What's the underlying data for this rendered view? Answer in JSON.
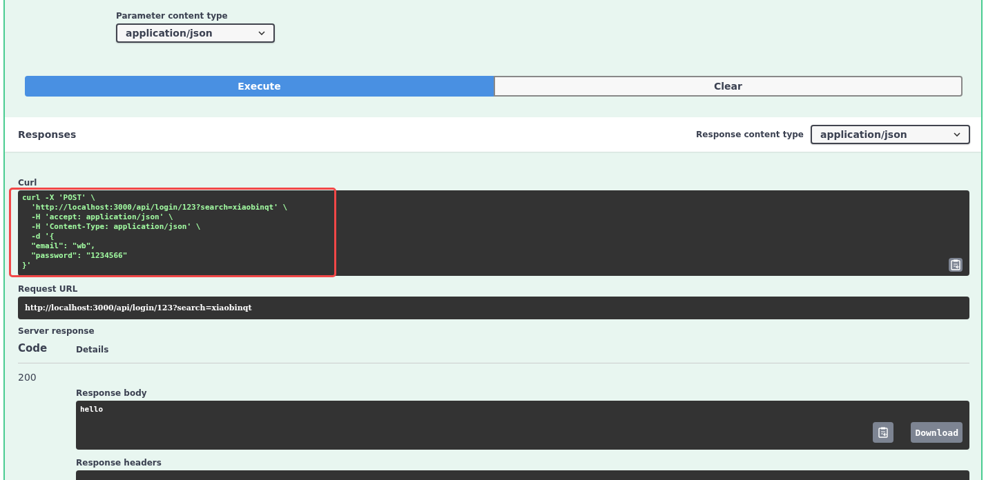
{
  "parameter_content_type": {
    "label": "Parameter content type",
    "value": "application/json"
  },
  "actions": [
    {
      "label": "Execute",
      "kind": "primary"
    },
    {
      "label": "Clear",
      "kind": "secondary"
    }
  ],
  "responses": {
    "title": "Responses",
    "content_type_label": "Response content type",
    "content_type_value": "application/json"
  },
  "curl": {
    "label": "Curl",
    "highlighted": true,
    "lines": [
      "curl -X 'POST' \\",
      "  'http://localhost:3000/api/login/123?search=xiaobinqt' \\",
      "  -H 'accept: application/json' \\",
      "  -H 'Content-Type: application/json' \\",
      "  -d '{",
      "  \"email\": \"wb\",",
      "  \"password\": \"1234566\"",
      "}'"
    ]
  },
  "request_url": {
    "label": "Request URL",
    "value": "http://localhost:3000/api/login/123?search=xiaobinqt"
  },
  "server_response": {
    "title": "Server response",
    "columns": [
      "Code",
      "Details"
    ],
    "rows": [
      {
        "code": "200",
        "body_label": "Response body",
        "body": "hello",
        "download": "Download",
        "headers_label": "Response headers"
      }
    ]
  }
}
